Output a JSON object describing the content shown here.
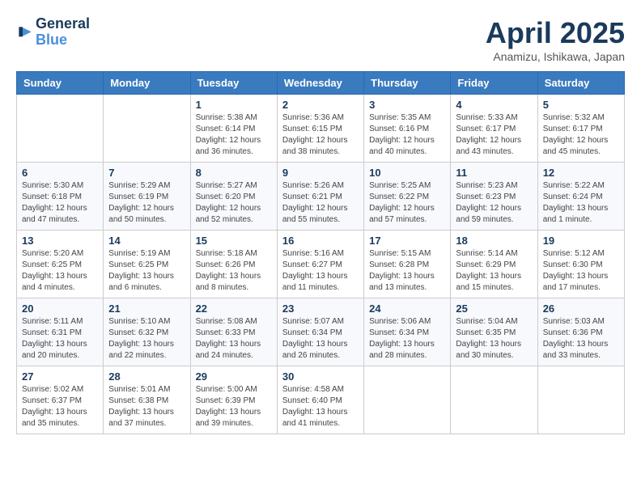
{
  "logo": {
    "line1": "General",
    "line2": "Blue"
  },
  "title": "April 2025",
  "location": "Anamizu, Ishikawa, Japan",
  "weekdays": [
    "Sunday",
    "Monday",
    "Tuesday",
    "Wednesday",
    "Thursday",
    "Friday",
    "Saturday"
  ],
  "weeks": [
    [
      null,
      null,
      {
        "day": 1,
        "sunrise": "5:38 AM",
        "sunset": "6:14 PM",
        "daylight": "12 hours and 36 minutes."
      },
      {
        "day": 2,
        "sunrise": "5:36 AM",
        "sunset": "6:15 PM",
        "daylight": "12 hours and 38 minutes."
      },
      {
        "day": 3,
        "sunrise": "5:35 AM",
        "sunset": "6:16 PM",
        "daylight": "12 hours and 40 minutes."
      },
      {
        "day": 4,
        "sunrise": "5:33 AM",
        "sunset": "6:17 PM",
        "daylight": "12 hours and 43 minutes."
      },
      {
        "day": 5,
        "sunrise": "5:32 AM",
        "sunset": "6:17 PM",
        "daylight": "12 hours and 45 minutes."
      }
    ],
    [
      {
        "day": 6,
        "sunrise": "5:30 AM",
        "sunset": "6:18 PM",
        "daylight": "12 hours and 47 minutes."
      },
      {
        "day": 7,
        "sunrise": "5:29 AM",
        "sunset": "6:19 PM",
        "daylight": "12 hours and 50 minutes."
      },
      {
        "day": 8,
        "sunrise": "5:27 AM",
        "sunset": "6:20 PM",
        "daylight": "12 hours and 52 minutes."
      },
      {
        "day": 9,
        "sunrise": "5:26 AM",
        "sunset": "6:21 PM",
        "daylight": "12 hours and 55 minutes."
      },
      {
        "day": 10,
        "sunrise": "5:25 AM",
        "sunset": "6:22 PM",
        "daylight": "12 hours and 57 minutes."
      },
      {
        "day": 11,
        "sunrise": "5:23 AM",
        "sunset": "6:23 PM",
        "daylight": "12 hours and 59 minutes."
      },
      {
        "day": 12,
        "sunrise": "5:22 AM",
        "sunset": "6:24 PM",
        "daylight": "13 hours and 1 minute."
      }
    ],
    [
      {
        "day": 13,
        "sunrise": "5:20 AM",
        "sunset": "6:25 PM",
        "daylight": "13 hours and 4 minutes."
      },
      {
        "day": 14,
        "sunrise": "5:19 AM",
        "sunset": "6:25 PM",
        "daylight": "13 hours and 6 minutes."
      },
      {
        "day": 15,
        "sunrise": "5:18 AM",
        "sunset": "6:26 PM",
        "daylight": "13 hours and 8 minutes."
      },
      {
        "day": 16,
        "sunrise": "5:16 AM",
        "sunset": "6:27 PM",
        "daylight": "13 hours and 11 minutes."
      },
      {
        "day": 17,
        "sunrise": "5:15 AM",
        "sunset": "6:28 PM",
        "daylight": "13 hours and 13 minutes."
      },
      {
        "day": 18,
        "sunrise": "5:14 AM",
        "sunset": "6:29 PM",
        "daylight": "13 hours and 15 minutes."
      },
      {
        "day": 19,
        "sunrise": "5:12 AM",
        "sunset": "6:30 PM",
        "daylight": "13 hours and 17 minutes."
      }
    ],
    [
      {
        "day": 20,
        "sunrise": "5:11 AM",
        "sunset": "6:31 PM",
        "daylight": "13 hours and 20 minutes."
      },
      {
        "day": 21,
        "sunrise": "5:10 AM",
        "sunset": "6:32 PM",
        "daylight": "13 hours and 22 minutes."
      },
      {
        "day": 22,
        "sunrise": "5:08 AM",
        "sunset": "6:33 PM",
        "daylight": "13 hours and 24 minutes."
      },
      {
        "day": 23,
        "sunrise": "5:07 AM",
        "sunset": "6:34 PM",
        "daylight": "13 hours and 26 minutes."
      },
      {
        "day": 24,
        "sunrise": "5:06 AM",
        "sunset": "6:34 PM",
        "daylight": "13 hours and 28 minutes."
      },
      {
        "day": 25,
        "sunrise": "5:04 AM",
        "sunset": "6:35 PM",
        "daylight": "13 hours and 30 minutes."
      },
      {
        "day": 26,
        "sunrise": "5:03 AM",
        "sunset": "6:36 PM",
        "daylight": "13 hours and 33 minutes."
      }
    ],
    [
      {
        "day": 27,
        "sunrise": "5:02 AM",
        "sunset": "6:37 PM",
        "daylight": "13 hours and 35 minutes."
      },
      {
        "day": 28,
        "sunrise": "5:01 AM",
        "sunset": "6:38 PM",
        "daylight": "13 hours and 37 minutes."
      },
      {
        "day": 29,
        "sunrise": "5:00 AM",
        "sunset": "6:39 PM",
        "daylight": "13 hours and 39 minutes."
      },
      {
        "day": 30,
        "sunrise": "4:58 AM",
        "sunset": "6:40 PM",
        "daylight": "13 hours and 41 minutes."
      },
      null,
      null,
      null
    ]
  ]
}
